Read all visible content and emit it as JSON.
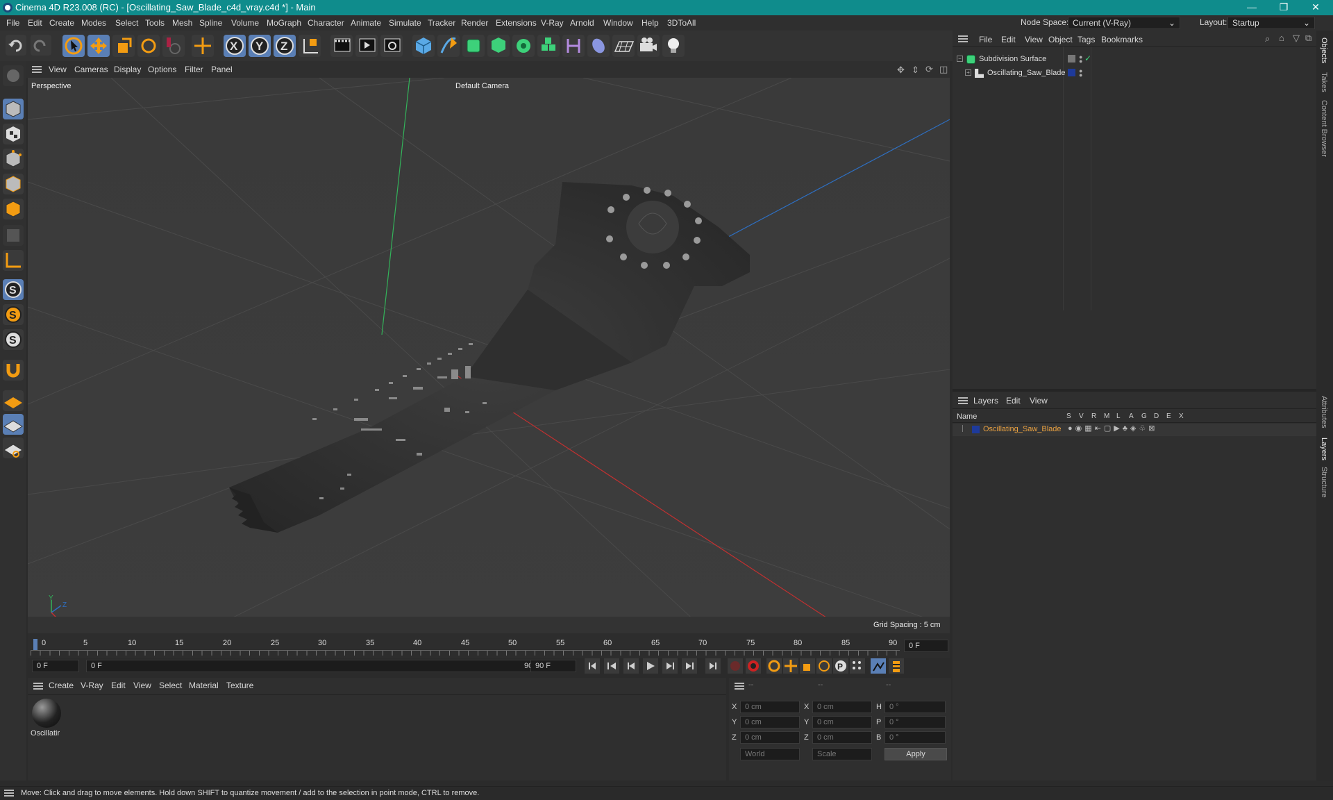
{
  "window": {
    "title": "Cinema 4D R23.008 (RC) - [Oscillating_Saw_Blade_c4d_vray.c4d *] - Main",
    "minimize": "—",
    "restore": "❐",
    "close": "✕"
  },
  "menu": {
    "items": [
      "File",
      "Edit",
      "Create",
      "Modes",
      "Select",
      "Tools",
      "Mesh",
      "Spline",
      "Volume",
      "MoGraph",
      "Character",
      "Animate",
      "Simulate",
      "Tracker",
      "Render",
      "Extensions",
      "V-Ray",
      "Arnold",
      "Window",
      "Help",
      "3DToAll"
    ],
    "node_space_label": "Node Space:",
    "node_space_value": "Current (V-Ray)",
    "layout_label": "Layout:",
    "layout_value": "Startup"
  },
  "viewport": {
    "menu": [
      "View",
      "Cameras",
      "Display",
      "Options",
      "Filter",
      "Panel"
    ],
    "projection": "Perspective",
    "camera": "Default Camera",
    "grid_spacing": "Grid Spacing : 5 cm",
    "axis_y": "Y",
    "axis_z": "Z",
    "axis_x": "X"
  },
  "timeline": {
    "ticks": [
      "0",
      "5",
      "10",
      "15",
      "20",
      "25",
      "30",
      "35",
      "40",
      "45",
      "50",
      "55",
      "60",
      "65",
      "70",
      "75",
      "80",
      "85",
      "90"
    ],
    "current_frame": "0 F",
    "start_field": "0 F",
    "range_start": "0 F",
    "range_end": "90 F",
    "end_field": "90 F"
  },
  "materials": {
    "menu": [
      "Create",
      "V-Ray",
      "Edit",
      "View",
      "Select",
      "Material",
      "Texture"
    ],
    "items": [
      {
        "name": "Oscillatir"
      }
    ]
  },
  "coords": {
    "headers": [
      "--",
      "--",
      "--"
    ],
    "rows": [
      {
        "a": "X",
        "av": "0 cm",
        "b": "X",
        "bv": "0 cm",
        "c": "H",
        "cv": "0 °"
      },
      {
        "a": "Y",
        "av": "0 cm",
        "b": "Y",
        "bv": "0 cm",
        "c": "P",
        "cv": "0 °"
      },
      {
        "a": "Z",
        "av": "0 cm",
        "b": "Z",
        "bv": "0 cm",
        "c": "B",
        "cv": "0 °"
      }
    ],
    "space": "World",
    "mode": "Scale",
    "apply": "Apply"
  },
  "objects": {
    "menu": [
      "File",
      "Edit",
      "View",
      "Object",
      "Tags",
      "Bookmarks"
    ],
    "tree": [
      {
        "name": "Subdivision Surface"
      },
      {
        "name": "Oscillating_Saw_Blade"
      }
    ]
  },
  "layers": {
    "menu": [
      "Layers",
      "Edit",
      "View"
    ],
    "name_header": "Name",
    "flags": [
      "S",
      "V",
      "R",
      "M",
      "L",
      "A",
      "G",
      "D",
      "E",
      "X"
    ],
    "rows": [
      {
        "name": "Oscillating_Saw_Blade",
        "color": "#1e3a9a"
      }
    ]
  },
  "side_tabs": [
    "Objects",
    "Takes",
    "Content Browser",
    "Attributes",
    "Layers",
    "Structure"
  ],
  "status": "Move: Click and drag to move elements. Hold down SHIFT to quantize movement / add to the selection in point mode, CTRL to remove.",
  "colors": {
    "accent": "#0f8c8c",
    "layer_name": "#e8a040",
    "grid_red": "#c23030",
    "grid_green": "#33b35a",
    "grid_blue": "#2e6fc2"
  }
}
